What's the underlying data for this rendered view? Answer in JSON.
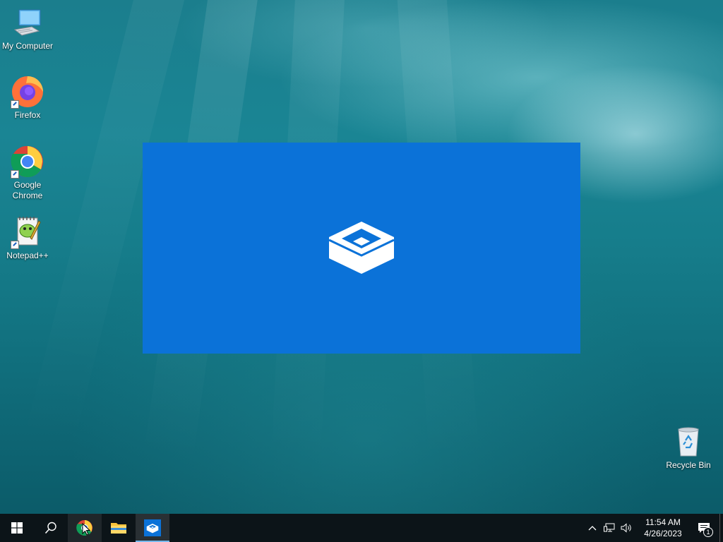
{
  "desktop": {
    "icons": [
      {
        "label": "My Computer",
        "icon": "computer-icon"
      },
      {
        "label": "Firefox",
        "icon": "firefox-icon"
      },
      {
        "label": "Google Chrome",
        "icon": "chrome-icon"
      },
      {
        "label": "Notepad++",
        "icon": "notepadpp-icon"
      },
      {
        "label": "Recycle Bin",
        "icon": "recycle-bin-icon"
      }
    ]
  },
  "splash": {
    "app_icon": "sandbox-box-icon",
    "background_color": "#0b72d8"
  },
  "taskbar": {
    "items": [
      {
        "name": "start",
        "icon": "windows-logo-icon"
      },
      {
        "name": "search",
        "icon": "search-icon"
      },
      {
        "name": "chrome",
        "icon": "chrome-icon"
      },
      {
        "name": "file-explorer",
        "icon": "folder-icon"
      },
      {
        "name": "sandbox",
        "icon": "sandbox-box-icon",
        "active": true
      }
    ],
    "tray": {
      "icons": [
        "chevron-up-icon",
        "network-icon",
        "volume-icon"
      ],
      "time": "11:54 AM",
      "date": "4/26/2023",
      "notification_count": "1"
    },
    "accent_color": "#76b9ed"
  }
}
